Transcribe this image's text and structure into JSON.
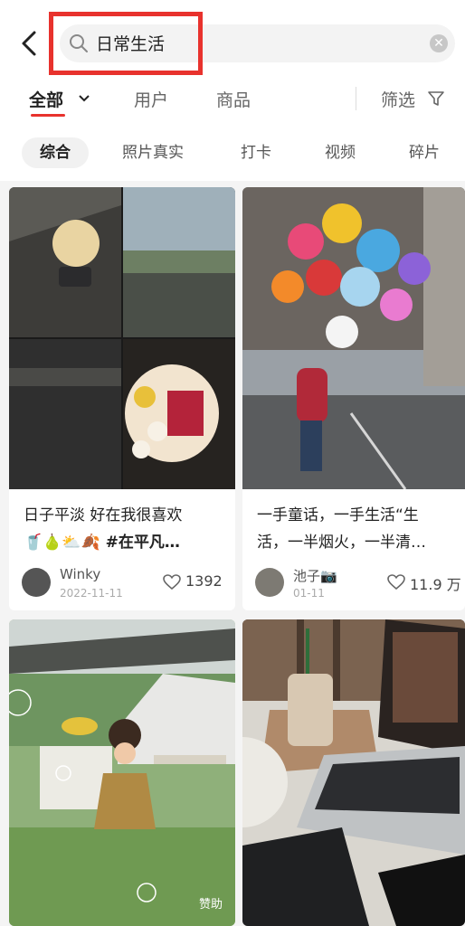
{
  "search": {
    "query": "日常生活"
  },
  "tabs": [
    {
      "label": "全部"
    },
    {
      "label": "用户"
    },
    {
      "label": "商品"
    }
  ],
  "filter_label": "筛选",
  "chips": [
    "综合",
    "照片真实",
    "打卡",
    "视频",
    "碎片"
  ],
  "cards": [
    {
      "title_line1": "日子平淡 好在我很喜欢",
      "title_line2": "🥤🍐⛅🍂 #在平凡…",
      "author": "Winky",
      "date": "2022-11-11",
      "likes": "1392"
    },
    {
      "title_line1": "一手童话，一手生活“生",
      "title_line2": "活，一半烟火，一半清…",
      "author": "池子📷",
      "date": "01-11",
      "likes": "11.9 万"
    },
    {
      "sponsored_label": "赞助"
    }
  ],
  "colors": {
    "accent": "#e8322d"
  }
}
